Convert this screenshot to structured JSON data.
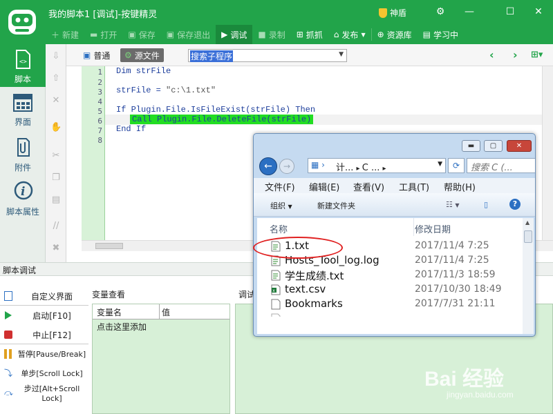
{
  "app": {
    "title": "我的脚本1 [调试]-按键精灵",
    "shield": "神盾",
    "colors": {
      "brand": "#22a44a",
      "code_keyword": "#1e3f9c",
      "highlight": "#22dd22"
    }
  },
  "toolbar": {
    "new": "新建",
    "open": "打开",
    "save": "保存",
    "save_exit": "保存退出",
    "debug": "调试",
    "record": "录制",
    "capture": "抓抓",
    "publish": "发布",
    "resources": "资源库",
    "learn": "学习中"
  },
  "leftnav": [
    {
      "label": "脚本",
      "icon": "script-icon"
    },
    {
      "label": "界面",
      "icon": "grid-icon"
    },
    {
      "label": "附件",
      "icon": "paperclip-icon"
    },
    {
      "label": "脚本属性",
      "icon": "info-icon"
    }
  ],
  "editor": {
    "view_normal": "普通",
    "view_source": "源文件",
    "search_placeholder": "搜索子程序",
    "line_numbers": [
      "1",
      "2",
      "3",
      "4",
      "5",
      "6",
      "7",
      "8"
    ],
    "code": {
      "l1": "Dim strFile",
      "l3a": "strFile = ",
      "l3b": "\"c:\\1.txt\"",
      "l5": "If Plugin.File.IsFileExist(strFile) Then",
      "l6": "Call Plugin.File.DeleteFile(strFile)",
      "l7": "End If"
    }
  },
  "debug": {
    "title": "脚本调试",
    "buttons": {
      "custom_ui": "自定义界面",
      "start": "启动[F10]",
      "stop": "中止[F12]",
      "pause": "暂停[Pause/Break]",
      "step": "单步[Scroll Lock]",
      "step_over": "步过[Alt+Scroll Lock]"
    },
    "vars_title": "变量查看",
    "col_name": "变量名",
    "col_value": "值",
    "add_hint": "点击这里添加",
    "output_title": "调试"
  },
  "explorer": {
    "addr_part1": "计...",
    "addr_part2": "C ...",
    "search_placeholder": "搜索 C (...",
    "menu": {
      "file": "文件(F)",
      "edit": "编辑(E)",
      "view": "查看(V)",
      "tools": "工具(T)",
      "help": "帮助(H)"
    },
    "cmd": {
      "organize": "组织",
      "new_folder": "新建文件夹"
    },
    "col_name": "名称",
    "col_date": "修改日期",
    "files": [
      {
        "name": "1.txt",
        "date": "2017/11/4 7:25",
        "icon": "text-file-icon"
      },
      {
        "name": "Hosts_Tool_log.log",
        "date": "2017/11/4 7:25",
        "icon": "text-file-icon"
      },
      {
        "name": "学生成绩.txt",
        "date": "2017/11/3 18:59",
        "icon": "text-file-icon"
      },
      {
        "name": "text.csv",
        "date": "2017/10/30 18:49",
        "icon": "excel-file-icon"
      },
      {
        "name": "Bookmarks",
        "date": "2017/7/31 21:11",
        "icon": "blank-file-icon"
      }
    ]
  },
  "watermark": {
    "brand": "Bai 经验",
    "url": "jingyan.baidu.com"
  }
}
